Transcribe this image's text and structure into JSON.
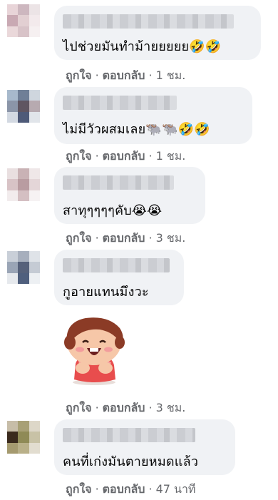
{
  "actions": {
    "like": "ถูกใจ",
    "reply": "ตอบกลับ",
    "separator": "·"
  },
  "comments": [
    {
      "text": "ไปช่วยมันทำม้ายยยยย",
      "emoji": "🤣🤣",
      "time": "1 ชม."
    },
    {
      "text": "ไม่มีวัวผสมเลย",
      "emoji": "🐃🐃🤣🤣",
      "time": "1 ชม."
    },
    {
      "text": "สาทุๆๆๆๆคับ",
      "emoji": "😭😭",
      "time": "3 ชม."
    },
    {
      "text": "กูอายแทนมึงวะ",
      "emoji": "",
      "time": "3 ชม.",
      "sticker": "laughing-girl-sticker"
    },
    {
      "text": "คนที่เก่งมันตายหมดแล้ว",
      "emoji": "",
      "time": "47 นาที"
    }
  ],
  "colors": {
    "bubble": "#f0f2f5",
    "meta_text": "#65676b",
    "body_text": "#050505"
  }
}
